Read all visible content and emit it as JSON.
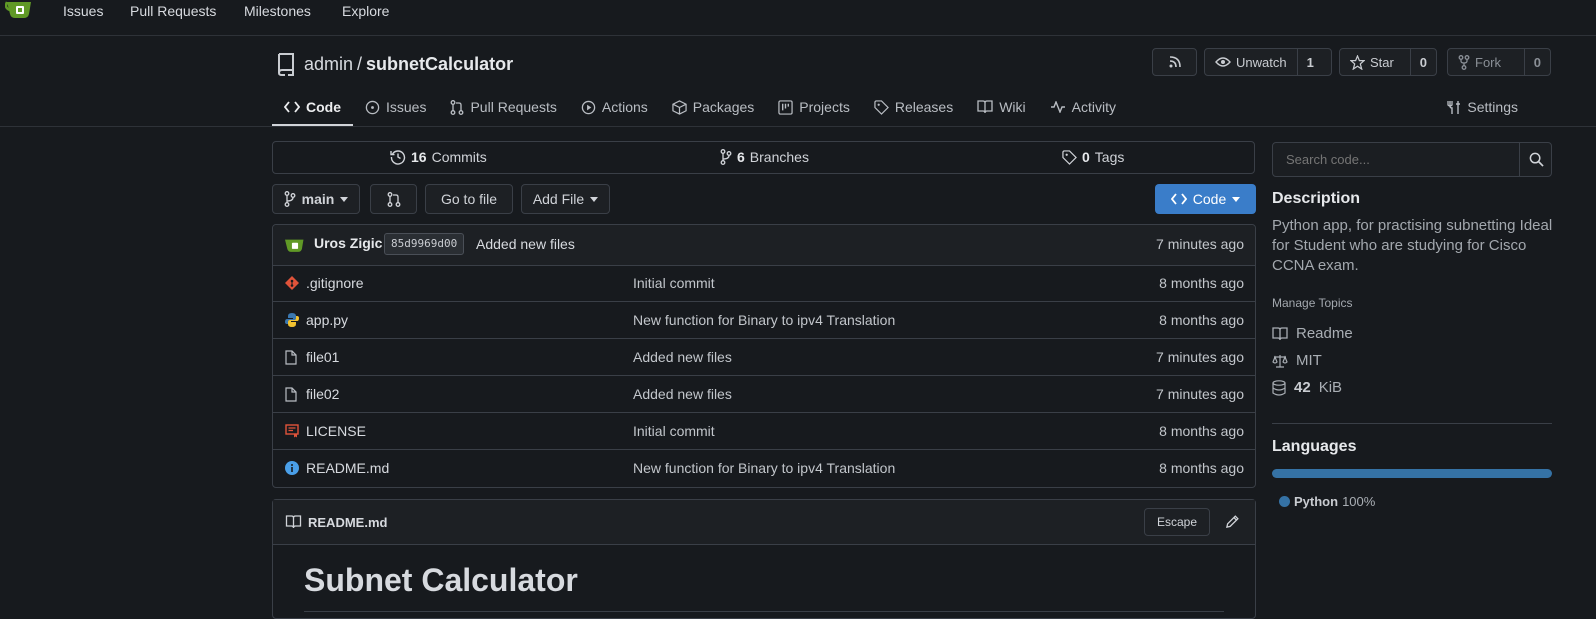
{
  "nav": {
    "links": [
      "Issues",
      "Pull Requests",
      "Milestones",
      "Explore"
    ]
  },
  "repo": {
    "owner": "admin",
    "separator": "/",
    "name": "subnetCalculator",
    "unwatch_label": "Unwatch",
    "watch_count": "1",
    "star_label": "Star",
    "star_count": "0",
    "fork_label": "Fork",
    "fork_count": "0"
  },
  "tabs": {
    "code": "Code",
    "issues": "Issues",
    "pulls": "Pull Requests",
    "actions": "Actions",
    "packages": "Packages",
    "projects": "Projects",
    "releases": "Releases",
    "wiki": "Wiki",
    "activity": "Activity",
    "settings": "Settings"
  },
  "stats": {
    "commits_count": "16",
    "commits_label": "Commits",
    "branches_count": "6",
    "branches_label": "Branches",
    "tags_count": "0",
    "tags_label": "Tags"
  },
  "toolbar": {
    "branch": "main",
    "go_to_file": "Go to file",
    "add_file": "Add File",
    "code": "Code"
  },
  "latest_commit": {
    "author": "Uros Zigic",
    "sha": "85d9969d00",
    "message": "Added new files",
    "time": "7 minutes ago"
  },
  "files": [
    {
      "name": ".gitignore",
      "message": "Initial commit",
      "time": "8 months ago",
      "icon": "git-icon"
    },
    {
      "name": "app.py",
      "message": "New function for Binary to ipv4 Translation",
      "time": "8 months ago",
      "icon": "python-icon"
    },
    {
      "name": "file01",
      "message": "Added new files",
      "time": "7 minutes ago",
      "icon": "file-icon"
    },
    {
      "name": "file02",
      "message": "Added new files",
      "time": "7 minutes ago",
      "icon": "file-icon"
    },
    {
      "name": "LICENSE",
      "message": "Initial commit",
      "time": "8 months ago",
      "icon": "license-icon"
    },
    {
      "name": "README.md",
      "message": "New function for Binary to ipv4 Translation",
      "time": "8 months ago",
      "icon": "info-icon"
    }
  ],
  "readme": {
    "filename": "README.md",
    "escape_label": "Escape",
    "heading": "Subnet Calculator"
  },
  "sidebar": {
    "search_placeholder": "Search code...",
    "description_heading": "Description",
    "description": "Python app, for practising subnetting Ideal for Student who are studying for Cisco CCNA exam.",
    "manage_topics": "Manage Topics",
    "readme": "Readme",
    "license": "MIT",
    "size_value": "42",
    "size_unit": "KiB",
    "languages_heading": "Languages",
    "language_name": "Python",
    "language_percent": "100%",
    "language_color": "#3572A5"
  },
  "colors": {
    "accent": "#3a7dc9",
    "background": "#171a1e"
  }
}
